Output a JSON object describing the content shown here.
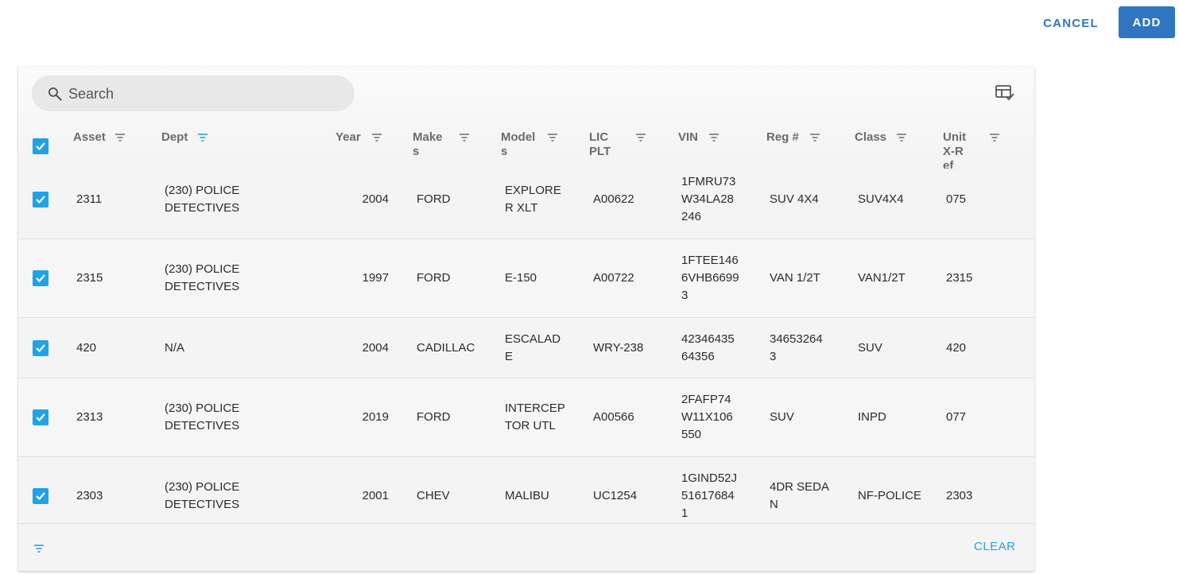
{
  "actions": {
    "cancel_label": "CANCEL",
    "add_label": "ADD"
  },
  "search": {
    "placeholder": "Search"
  },
  "columns": [
    {
      "label": "Asset"
    },
    {
      "label": "Dept"
    },
    {
      "label": "Year"
    },
    {
      "label": "Makes"
    },
    {
      "label": "Models"
    },
    {
      "label": "LIC PLT"
    },
    {
      "label": "VIN"
    },
    {
      "label": "Reg #"
    },
    {
      "label": "Class"
    },
    {
      "label": "Unit X-Ref"
    }
  ],
  "rows": [
    {
      "asset": "2311",
      "dept": "(230) POLICE DETECTIVES",
      "year": "2004",
      "make": "FORD",
      "model": "EXPLORER XLT",
      "lic": "A00622",
      "vin": "1FMRU73 W34LA28 246",
      "reg": "SUV 4X4",
      "class": "SUV4X4",
      "xref": "075"
    },
    {
      "asset": "2315",
      "dept": "(230) POLICE DETECTIVES",
      "year": "1997",
      "make": "FORD",
      "model": "E-150",
      "lic": "A00722",
      "vin": "1FTEE146 6VHB6699 3",
      "reg": "VAN 1/2T",
      "class": "VAN1/2T",
      "xref": "2315"
    },
    {
      "asset": "420",
      "dept": "N/A",
      "year": "2004",
      "make": "CADILLAC",
      "model": "ESCALAD E",
      "lic": "WRY-238",
      "vin": "42346435 64356",
      "reg": "34653264 3",
      "class": "SUV",
      "xref": "420"
    },
    {
      "asset": "2313",
      "dept": "(230) POLICE DETECTIVES",
      "year": "2019",
      "make": "FORD",
      "model": "INTERCEP TOR UTL",
      "lic": "A00566",
      "vin": "2FAFP74 W11X106 550",
      "reg": "SUV",
      "class": "INPD",
      "xref": "077"
    },
    {
      "asset": "2303",
      "dept": "(230) POLICE DETECTIVES",
      "year": "2001",
      "make": "CHEV",
      "model": "MALIBU",
      "lic": "UC1254",
      "vin": "1GIND52J 51617684 1",
      "reg": "4DR SEDAN",
      "class": "NF-POLICE",
      "xref": "2303"
    }
  ],
  "footer": {
    "clear_label": "CLEAR"
  },
  "colors": {
    "accent": "#2f75c0",
    "checkbox": "#1fa3e6",
    "active_filter": "#1fa3e6"
  }
}
